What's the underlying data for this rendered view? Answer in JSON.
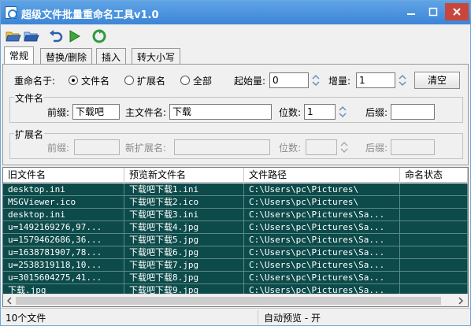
{
  "window": {
    "title": "超级文件批量重命名工具v1.0",
    "minimize_icon": "minimize-icon",
    "maximize_icon": "maximize-icon",
    "close_icon": "close-icon"
  },
  "toolbar": {
    "icons": [
      "open-folder-icon",
      "open-file-icon",
      "undo-icon",
      "run-icon",
      "recycle-icon"
    ]
  },
  "tabs": [
    {
      "label": "常规",
      "active": true
    },
    {
      "label": "替换/删除",
      "active": false
    },
    {
      "label": "插入",
      "active": false
    },
    {
      "label": "转大小写",
      "active": false
    }
  ],
  "rename_target": {
    "label": "重命名于:",
    "options": [
      {
        "label": "文件名",
        "selected": true
      },
      {
        "label": "扩展名",
        "selected": false
      },
      {
        "label": "全部",
        "selected": false
      }
    ]
  },
  "start": {
    "label": "起始量:",
    "value": "0"
  },
  "increment": {
    "label": "增量:",
    "value": "1"
  },
  "clear_button": "清空",
  "filename_group": {
    "legend": "文件名",
    "prefix_label": "前缀:",
    "prefix_value": "下载吧",
    "main_label": "主文件名:",
    "main_value": "下载",
    "digits_label": "位数:",
    "digits_value": "1",
    "suffix_label": "后缀:",
    "suffix_value": ""
  },
  "ext_group": {
    "legend": "扩展名",
    "prefix_label": "前缀:",
    "new_ext_label": "新扩展名:",
    "digits_label": "位数:",
    "suffix_label": "后缀:"
  },
  "list": {
    "columns": [
      "旧文件名",
      "预览新文件名",
      "文件路径",
      "命名状态"
    ],
    "rows": [
      [
        "desktop.ini",
        "下载吧下载1.ini",
        "C:\\Users\\pc\\Pictures\\",
        ""
      ],
      [
        "MSGViewer.ico",
        "下载吧下载2.ico",
        "C:\\Users\\pc\\Pictures\\",
        ""
      ],
      [
        "desktop.ini",
        "下载吧下载3.ini",
        "C:\\Users\\pc\\Pictures\\Sa...",
        ""
      ],
      [
        "u=1492169276,97...",
        "下载吧下载4.jpg",
        "C:\\Users\\pc\\Pictures\\Sa...",
        ""
      ],
      [
        "u=1579462686,36...",
        "下载吧下载5.jpg",
        "C:\\Users\\pc\\Pictures\\Sa...",
        ""
      ],
      [
        "u=1638781907,78...",
        "下载吧下载6.jpg",
        "C:\\Users\\pc\\Pictures\\Sa...",
        ""
      ],
      [
        "u=2538319118,10...",
        "下载吧下载7.jpg",
        "C:\\Users\\pc\\Pictures\\Sa...",
        ""
      ],
      [
        "u=3015604275,41...",
        "下载吧下载8.jpg",
        "C:\\Users\\pc\\Pictures\\Sa...",
        ""
      ],
      [
        "下载.jpg",
        "下载吧下载9.jpg",
        "C:\\Users\\pc\\Pictures\\Sa...",
        ""
      ]
    ]
  },
  "status": {
    "count": "10个文件",
    "preview": "自动预览 - 开"
  },
  "colors": {
    "row_bg": "#0d4a4a",
    "title_bg": "#3c86d6"
  }
}
